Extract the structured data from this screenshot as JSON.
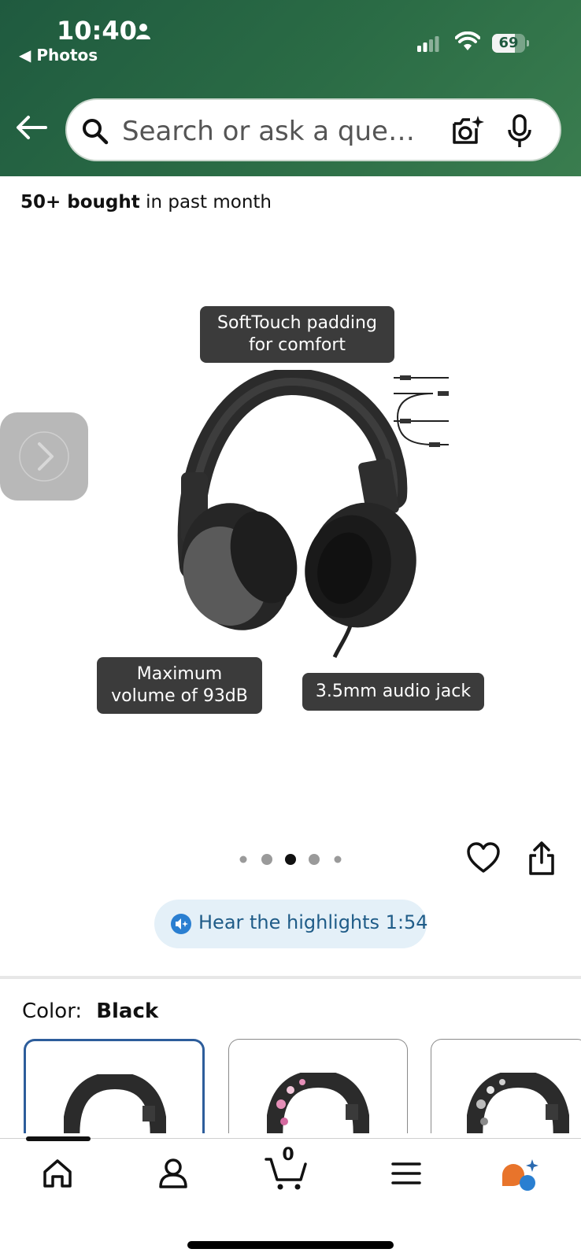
{
  "status_bar": {
    "time": "10:40",
    "back_app": "◀ Photos",
    "battery": "69"
  },
  "search": {
    "placeholder": "Search or ask a que…"
  },
  "product": {
    "bought_bold": "50+ bought",
    "bought_rest": " in past month",
    "callouts": {
      "padding_line1": "SoftTouch padding",
      "padding_line2": "for comfort",
      "volume_line1": "Maximum",
      "volume_line2": "volume of 93dB",
      "jack": "3.5mm audio jack"
    },
    "gallery": {
      "total_images": 5,
      "active_index": 2
    },
    "highlights_label": "Hear the highlights 1:54",
    "color_label": "Color:",
    "color_value": "Black"
  },
  "colors": {
    "accent_green": "#2a6b45",
    "selected_border": "#2d5d9b",
    "highlight_bg": "#e4f0f8",
    "highlight_text": "#1f5c88"
  },
  "bottom_nav": {
    "items": [
      "home-icon",
      "account-icon",
      "cart-icon",
      "menu-icon",
      "rufus-icon"
    ],
    "cart_count": "0"
  }
}
